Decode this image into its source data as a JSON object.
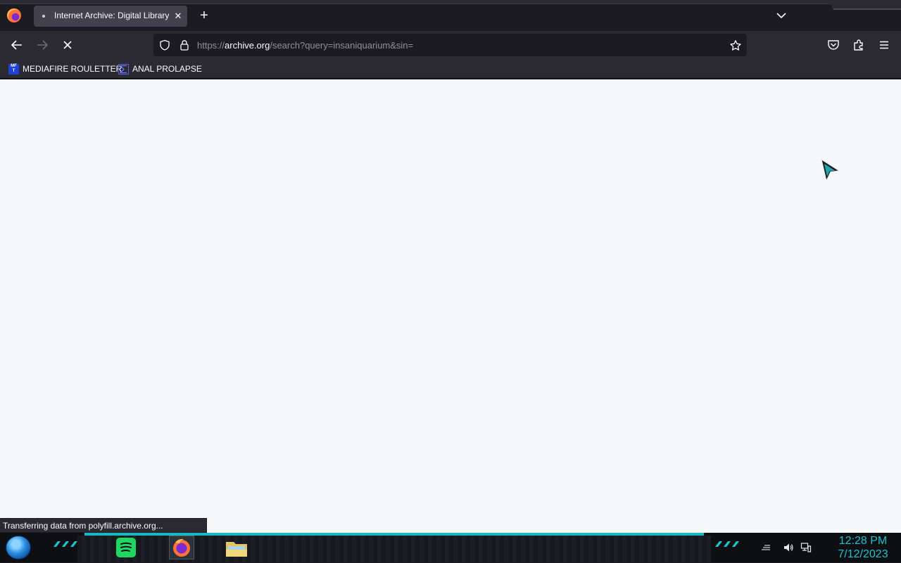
{
  "browser": {
    "tab": {
      "title": "Internet Archive: Digital Library"
    },
    "url": {
      "scheme": "https://",
      "host": "archive.org",
      "path": "/search?query=insaniquarium&sin="
    },
    "bookmarks": [
      {
        "label": "MEDIAFIRE ROULETTER",
        "icon": "mediafire-icon",
        "icon_text": "MF\nT"
      },
      {
        "label": "ANAL PROLAPSE",
        "icon": "sigma-icon"
      }
    ],
    "status_text": "Transferring data from polyfill.archive.org..."
  },
  "taskbar": {
    "apps": [
      {
        "name": "spotify",
        "icon": "spotify-icon"
      },
      {
        "name": "firefox",
        "icon": "firefox-icon",
        "active": true
      },
      {
        "name": "file-explorer",
        "icon": "folder-icon"
      }
    ],
    "clock": {
      "time": "12:28 PM",
      "date": "7/12/2023"
    },
    "accent_color": "#19c6d0"
  },
  "colors": {
    "chrome_dark": "#1c1b22",
    "chrome": "#2b2a33",
    "page_bg": "#f6f7f9"
  }
}
